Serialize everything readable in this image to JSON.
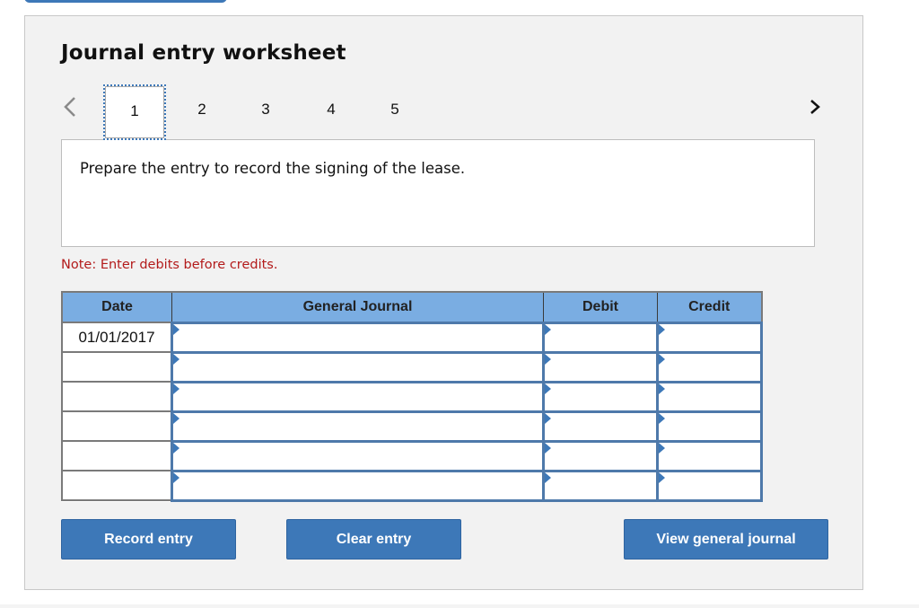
{
  "worksheet": {
    "title": "Journal entry worksheet",
    "tabs": [
      {
        "label": "1",
        "active": true
      },
      {
        "label": "2",
        "active": false
      },
      {
        "label": "3",
        "active": false
      },
      {
        "label": "4",
        "active": false
      },
      {
        "label": "5",
        "active": false
      }
    ],
    "nav": {
      "prev_icon": "chevron-left-icon",
      "next_icon": "chevron-right-icon"
    },
    "prompt": "Prepare the entry to record the signing of the lease.",
    "note": "Note: Enter debits before credits.",
    "colors": {
      "accent": "#3d78b8",
      "header_bg": "#7aade2",
      "note": "#b31b1b",
      "panel_bg": "#f2f2f2"
    }
  },
  "table": {
    "headers": {
      "date": "Date",
      "general_journal": "General Journal",
      "debit": "Debit",
      "credit": "Credit"
    },
    "rows": [
      {
        "date": "01/01/2017",
        "account": "",
        "debit": "",
        "credit": ""
      },
      {
        "date": "",
        "account": "",
        "debit": "",
        "credit": ""
      },
      {
        "date": "",
        "account": "",
        "debit": "",
        "credit": ""
      },
      {
        "date": "",
        "account": "",
        "debit": "",
        "credit": ""
      },
      {
        "date": "",
        "account": "",
        "debit": "",
        "credit": ""
      },
      {
        "date": "",
        "account": "",
        "debit": "",
        "credit": ""
      }
    ]
  },
  "buttons": {
    "record": "Record entry",
    "clear": "Clear entry",
    "view": "View general journal"
  }
}
